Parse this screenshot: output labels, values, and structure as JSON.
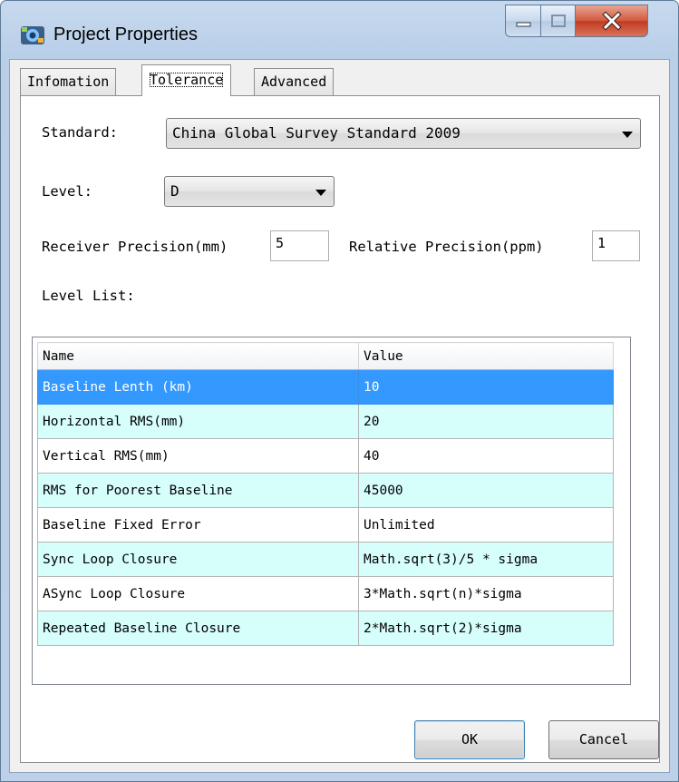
{
  "window": {
    "title": "Project Properties",
    "icon": "project-icon",
    "controls": [
      "minimize-icon",
      "maximize-icon",
      "close-icon"
    ]
  },
  "tabs": [
    {
      "label": "Infomation",
      "active": false
    },
    {
      "label": "Tolerance",
      "active": true
    },
    {
      "label": "Advanced",
      "active": false
    }
  ],
  "form": {
    "standard_label": "Standard:",
    "standard_value": "China Global Survey Standard 2009",
    "level_label": "Level:",
    "level_value": "D",
    "receiver_label": "Receiver Precision(mm)",
    "receiver_value": "5",
    "relative_label": "Relative Precision(ppm)",
    "relative_value": "1",
    "list_label": "Level List:"
  },
  "table": {
    "columns": [
      "Name",
      "Value"
    ],
    "rows": [
      {
        "name": "Baseline Lenth (km)",
        "value": "10"
      },
      {
        "name": "Horizontal RMS(mm)",
        "value": "20"
      },
      {
        "name": "Vertical RMS(mm)",
        "value": "40"
      },
      {
        "name": "RMS for Poorest Baseline",
        "value": "45000"
      },
      {
        "name": "Baseline Fixed Error",
        "value": "Unlimited"
      },
      {
        "name": "Sync Loop Closure",
        "value": "Math.sqrt(3)/5 * sigma"
      },
      {
        "name": "ASync Loop Closure",
        "value": "3*Math.sqrt(n)*sigma"
      },
      {
        "name": "Repeated Baseline Closure",
        "value": "2*Math.sqrt(2)*sigma"
      }
    ],
    "selected_row": 0
  },
  "buttons": {
    "ok": "OK",
    "cancel": "Cancel"
  },
  "colors": {
    "selection": "#3399ff",
    "alt_row": "#d6fffc",
    "frame": "#bcd1e9",
    "close": "#c13a20"
  }
}
